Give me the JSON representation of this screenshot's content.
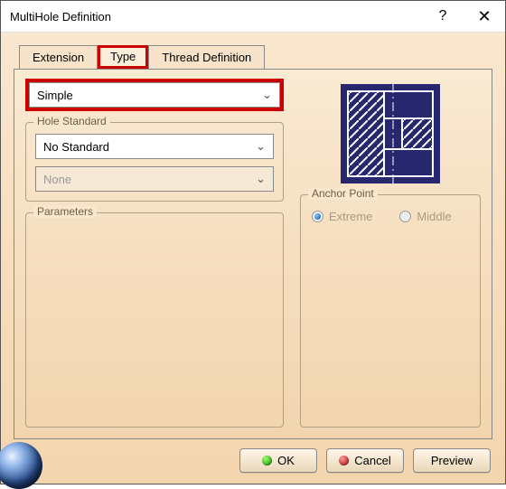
{
  "window": {
    "title": "MultiHole Definition"
  },
  "tabs": {
    "extension": "Extension",
    "type": "Type",
    "thread": "Thread Definition"
  },
  "type_combo": {
    "value": "Simple"
  },
  "hole_standard": {
    "title": "Hole Standard",
    "standard": "No Standard",
    "secondary": "None"
  },
  "parameters": {
    "title": "Parameters"
  },
  "anchor": {
    "title": "Anchor Point",
    "extreme": "Extreme",
    "middle": "Middle"
  },
  "buttons": {
    "ok": "OK",
    "cancel": "Cancel",
    "preview": "Preview"
  }
}
